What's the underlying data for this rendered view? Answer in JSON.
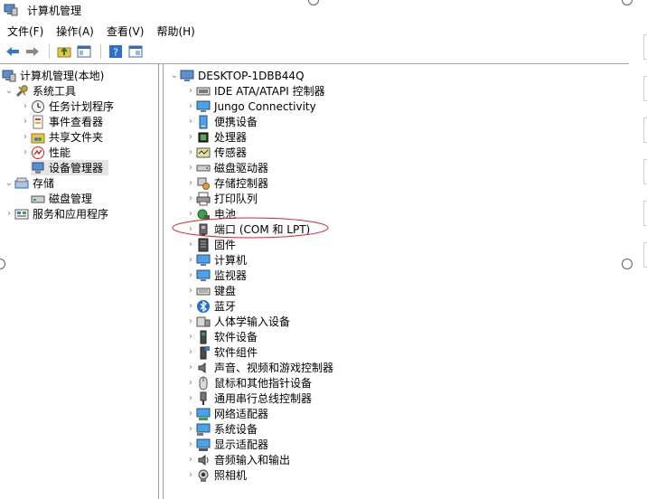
{
  "window": {
    "title": "计算机管理"
  },
  "menubar": [
    {
      "label": "文件(F)"
    },
    {
      "label": "操作(A)"
    },
    {
      "label": "查看(V)"
    },
    {
      "label": "帮助(H)"
    }
  ],
  "toolbar": [
    {
      "icon": "back-arrow-icon"
    },
    {
      "icon": "forward-arrow-icon"
    },
    {
      "icon": "up-folder-icon"
    },
    {
      "icon": "show-hide-console-tree-icon"
    },
    {
      "icon": "help-icon"
    },
    {
      "icon": "properties-icon"
    }
  ],
  "left_tree": {
    "root": {
      "label": "计算机管理(本地)",
      "icon": "computer-management-icon"
    },
    "system_tools": {
      "label": "系统工具",
      "icon": "tools-icon"
    },
    "system_children": [
      {
        "label": "任务计划程序",
        "icon": "clock-icon"
      },
      {
        "label": "事件查看器",
        "icon": "event-viewer-icon"
      },
      {
        "label": "共享文件夹",
        "icon": "shared-folder-icon"
      },
      {
        "label": "性能",
        "icon": "performance-icon"
      },
      {
        "label": "设备管理器",
        "icon": "device-manager-icon"
      }
    ],
    "storage": {
      "label": "存储",
      "icon": "storage-icon"
    },
    "disk_management": {
      "label": "磁盘管理",
      "icon": "disk-icon"
    },
    "services": {
      "label": "服务和应用程序",
      "icon": "services-icon"
    }
  },
  "right_tree": {
    "computer": {
      "label": "DESKTOP-1DBB44Q",
      "icon": "computer-icon"
    },
    "categories": [
      {
        "label": "IDE ATA/ATAPI 控制器",
        "icon": "ide-controller-icon"
      },
      {
        "label": "Jungo Connectivity",
        "icon": "monitor-icon"
      },
      {
        "label": "便携设备",
        "icon": "portable-device-icon"
      },
      {
        "label": "处理器",
        "icon": "processor-icon"
      },
      {
        "label": "传感器",
        "icon": "sensor-icon"
      },
      {
        "label": "磁盘驱动器",
        "icon": "disk-drive-icon"
      },
      {
        "label": "存储控制器",
        "icon": "storage-controller-icon"
      },
      {
        "label": "打印队列",
        "icon": "printer-icon"
      },
      {
        "label": "电池",
        "icon": "battery-icon"
      },
      {
        "label": "端口 (COM 和 LPT)",
        "icon": "port-icon"
      },
      {
        "label": "固件",
        "icon": "firmware-icon"
      },
      {
        "label": "计算机",
        "icon": "computer-icon"
      },
      {
        "label": "监视器",
        "icon": "monitor-icon"
      },
      {
        "label": "键盘",
        "icon": "keyboard-icon"
      },
      {
        "label": "蓝牙",
        "icon": "bluetooth-icon"
      },
      {
        "label": "人体学输入设备",
        "icon": "hid-icon"
      },
      {
        "label": "软件设备",
        "icon": "software-device-icon"
      },
      {
        "label": "软件组件",
        "icon": "software-component-icon"
      },
      {
        "label": "声音、视频和游戏控制器",
        "icon": "speaker-icon"
      },
      {
        "label": "鼠标和其他指针设备",
        "icon": "mouse-icon"
      },
      {
        "label": "通用串行总线控制器",
        "icon": "usb-icon"
      },
      {
        "label": "网络适配器",
        "icon": "network-adapter-icon"
      },
      {
        "label": "系统设备",
        "icon": "system-device-icon"
      },
      {
        "label": "显示适配器",
        "icon": "display-adapter-icon"
      },
      {
        "label": "音频输入和输出",
        "icon": "audio-io-icon"
      },
      {
        "label": "照相机",
        "icon": "camera-icon"
      }
    ]
  },
  "annotation": {
    "color": "#d9262e"
  },
  "colors": {
    "accent": "#1e6fd0",
    "selection": "#e5e5e5"
  }
}
